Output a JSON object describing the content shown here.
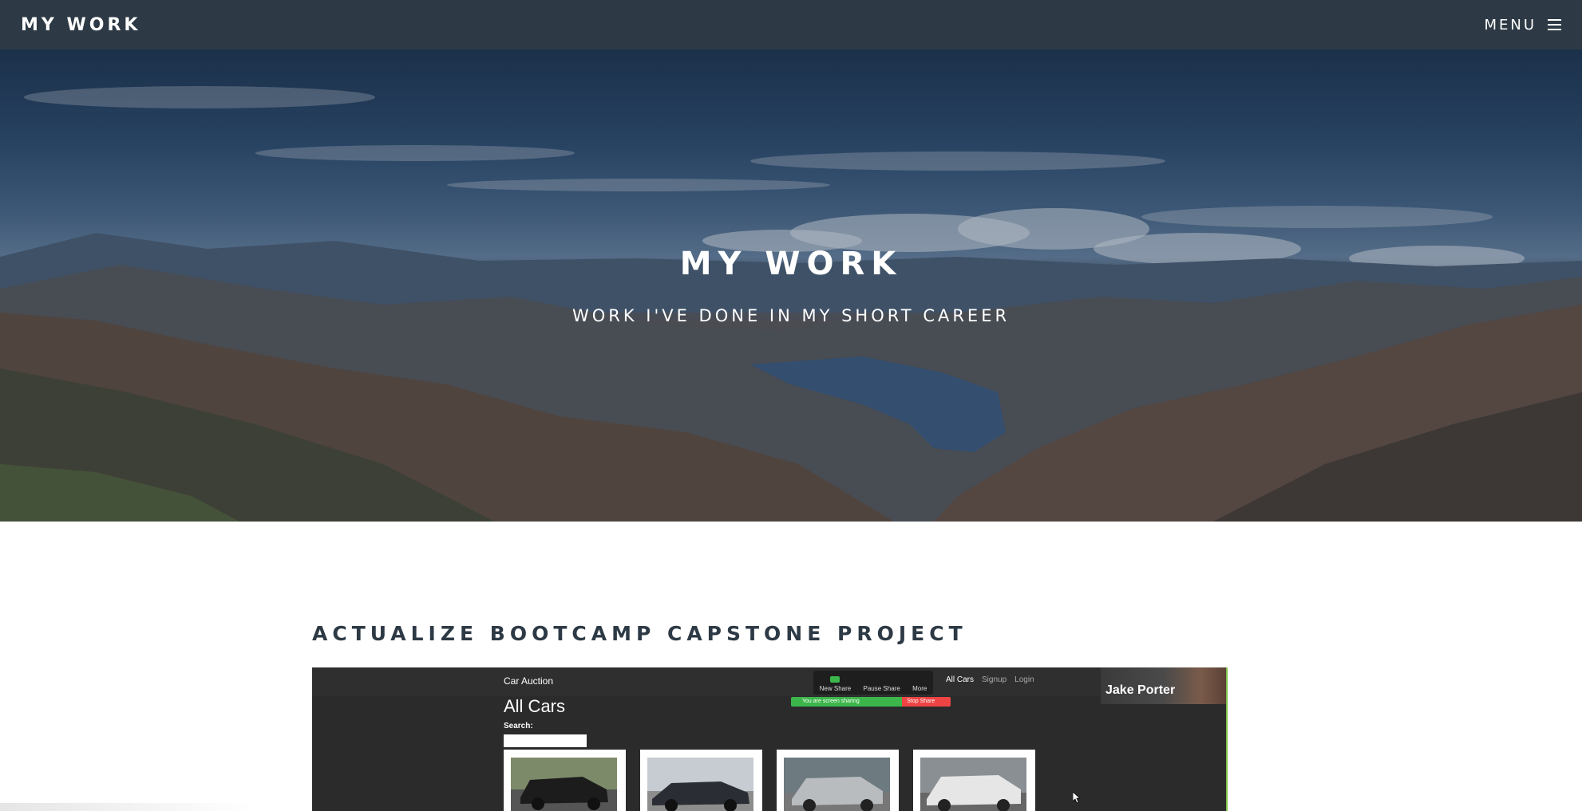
{
  "navbar": {
    "brand": "MY WORK",
    "menu_label": "MENU",
    "menu_icon": "hamburger-icon"
  },
  "hero": {
    "title": "MY WORK",
    "subtitle": "WORK I'VE DONE IN MY SHORT CAREER"
  },
  "projects": [
    {
      "title": "ACTUALIZE BOOTCAMP CAPSTONE PROJECT",
      "video": {
        "app_title": "Car Auction",
        "heading": "All Cars",
        "search_label": "Search:",
        "nav_links": [
          "All Cars",
          "Signup",
          "Login"
        ],
        "zoom_controls": [
          "New Share",
          "Pause Share",
          "More"
        ],
        "zoom_status": "You are screen sharing",
        "zoom_stop": "Stop Share",
        "participant_name": "Jake Porter"
      }
    }
  ],
  "colors": {
    "navbar_bg": "#2d3a45",
    "section_title": "#2d3a45",
    "accent_green": "#7bc043"
  }
}
